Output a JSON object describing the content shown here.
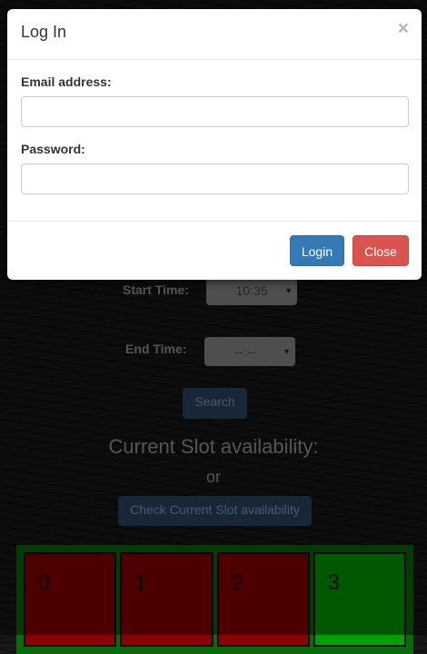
{
  "modal": {
    "title": "Log In",
    "close_glyph": "×",
    "email_label": "Email address:",
    "email_value": "",
    "password_label": "Password:",
    "password_value": "",
    "login_label": "Login",
    "close_label": "Close"
  },
  "form": {
    "start_label": "Start Time:",
    "start_value": "10:35",
    "end_label": "End Time:",
    "end_value": "--:--",
    "search_label": "Search"
  },
  "availability": {
    "heading": "Current Slot availability:",
    "or_text": "or",
    "check_label": "Check Current Slot availability"
  },
  "slots": [
    {
      "label": "0",
      "status": "occupied",
      "color": "#8b0000"
    },
    {
      "label": "1",
      "status": "occupied",
      "color": "#8b0000"
    },
    {
      "label": "2",
      "status": "occupied",
      "color": "#8b0000"
    },
    {
      "label": "3",
      "status": "available",
      "color": "#00a000"
    }
  ],
  "colors": {
    "primary": "#337ab7",
    "danger": "#d9534f",
    "occupied": "#8b0000",
    "available": "#00a000"
  }
}
